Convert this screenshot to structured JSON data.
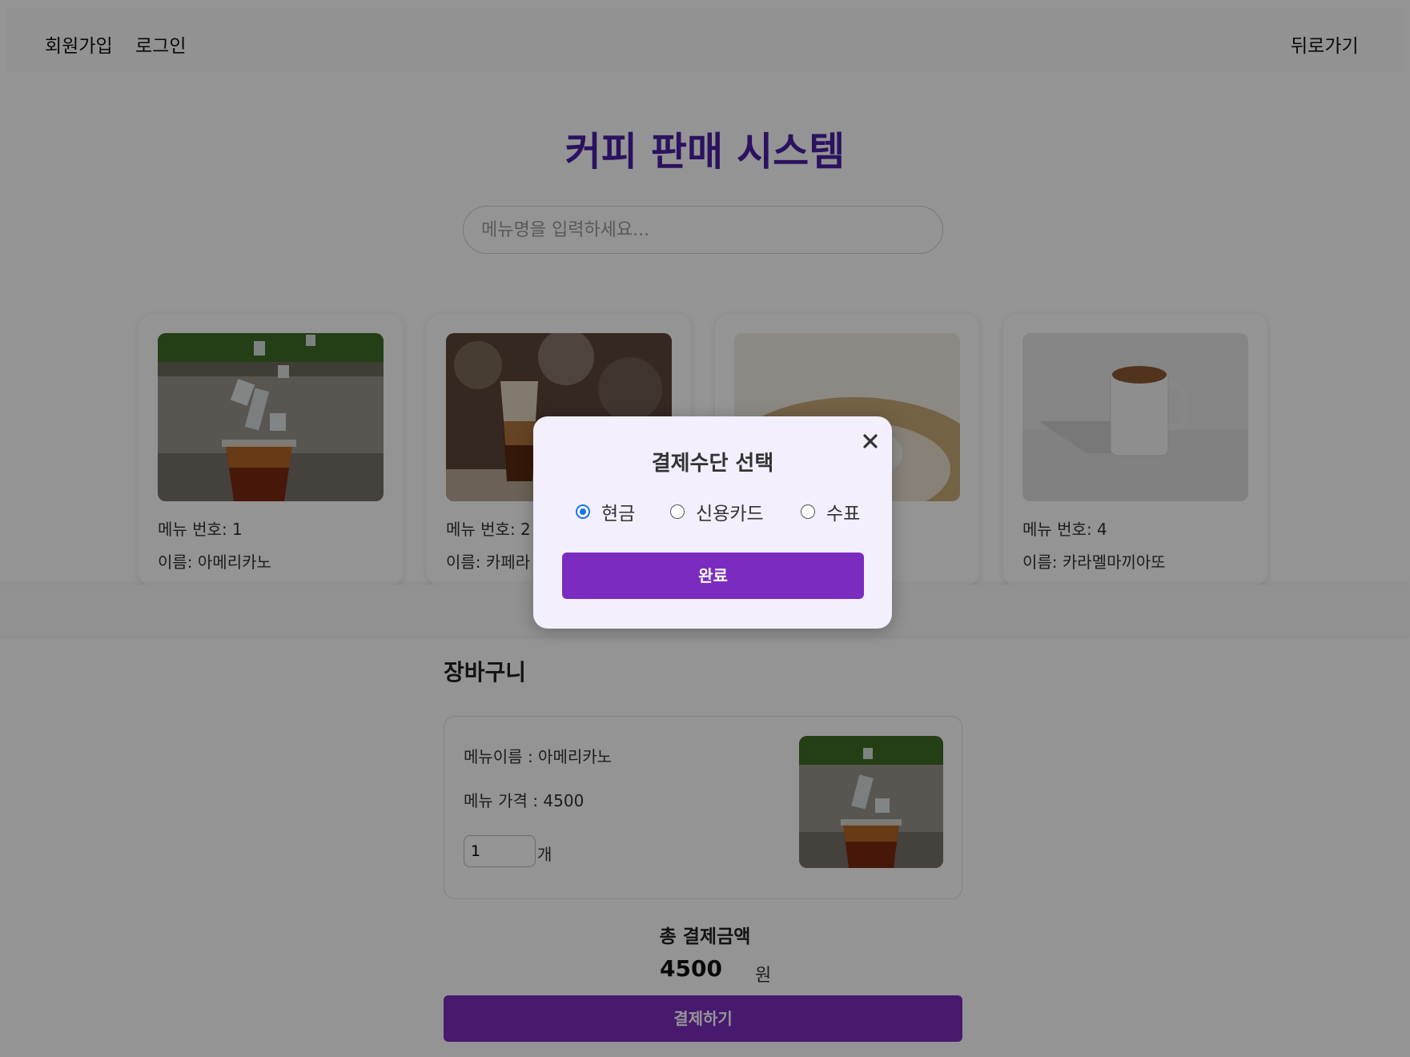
{
  "header": {
    "signup": "회원가입",
    "login": "로그인",
    "back": "뒤로가기"
  },
  "page_title": "커피 판매 시스템",
  "search": {
    "placeholder": "메뉴명을 입력하세요..."
  },
  "menu": [
    {
      "number": "메뉴 번호: 1",
      "name": "이름: 아메리카노",
      "icon": "iced-americano-image"
    },
    {
      "number": "메뉴 번호: 2",
      "name": "이름: 카페라",
      "icon": "iced-latte-image"
    },
    {
      "number": "",
      "name": "",
      "icon": "coffee-on-mat-image"
    },
    {
      "number": "메뉴 번호: 4",
      "name": "이름: 카라멜마끼아또",
      "icon": "coffee-mug-image"
    }
  ],
  "cart": {
    "title": "장바구니",
    "item": {
      "name": "메뉴이름 : 아메리카노",
      "price": "메뉴 가격 : 4500",
      "quantity": "1",
      "unit": "개"
    },
    "total_label": "총 결제금액",
    "total_value": "4500",
    "total_unit": "원",
    "pay_button": "결제하기"
  },
  "modal": {
    "title": "결제수단 선택",
    "options": [
      {
        "label": "현금",
        "checked": true
      },
      {
        "label": "신용카드",
        "checked": false
      },
      {
        "label": "수표",
        "checked": false
      }
    ],
    "confirm": "완료"
  },
  "colors": {
    "accent": "#7b2cbf",
    "title": "#4b1fa6",
    "radio": "#1a73e8"
  }
}
